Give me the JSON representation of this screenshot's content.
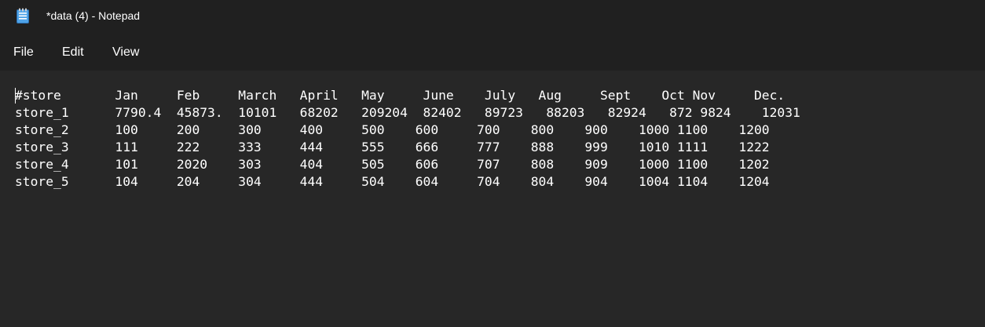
{
  "window": {
    "title": "*data (4) - Notepad",
    "icon": "notepad-icon"
  },
  "menu": {
    "file": "File",
    "edit": "Edit",
    "view": "View"
  },
  "document": {
    "lines": [
      "#store       Jan     Feb     March   April   May     June    July   Aug     Sept    Oct Nov     Dec.",
      "store_1      7790.4  45873.  10101   68202   209204  82402   89723   88203   82924   872 9824    12031",
      "store_2      100     200     300     400     500    600     700    800    900    1000 1100    1200",
      "store_3      111     222     333     444     555    666     777    888    999    1010 1111    1222",
      "store_4      101     2020    303     404     505    606     707    808    909    1000 1100    1202",
      "store_5      104     204     304     444     504    604     704    804    904    1004 1104    1204"
    ]
  },
  "colors": {
    "background": "#272727",
    "titlebar": "#202020",
    "text": "#ffffff"
  }
}
